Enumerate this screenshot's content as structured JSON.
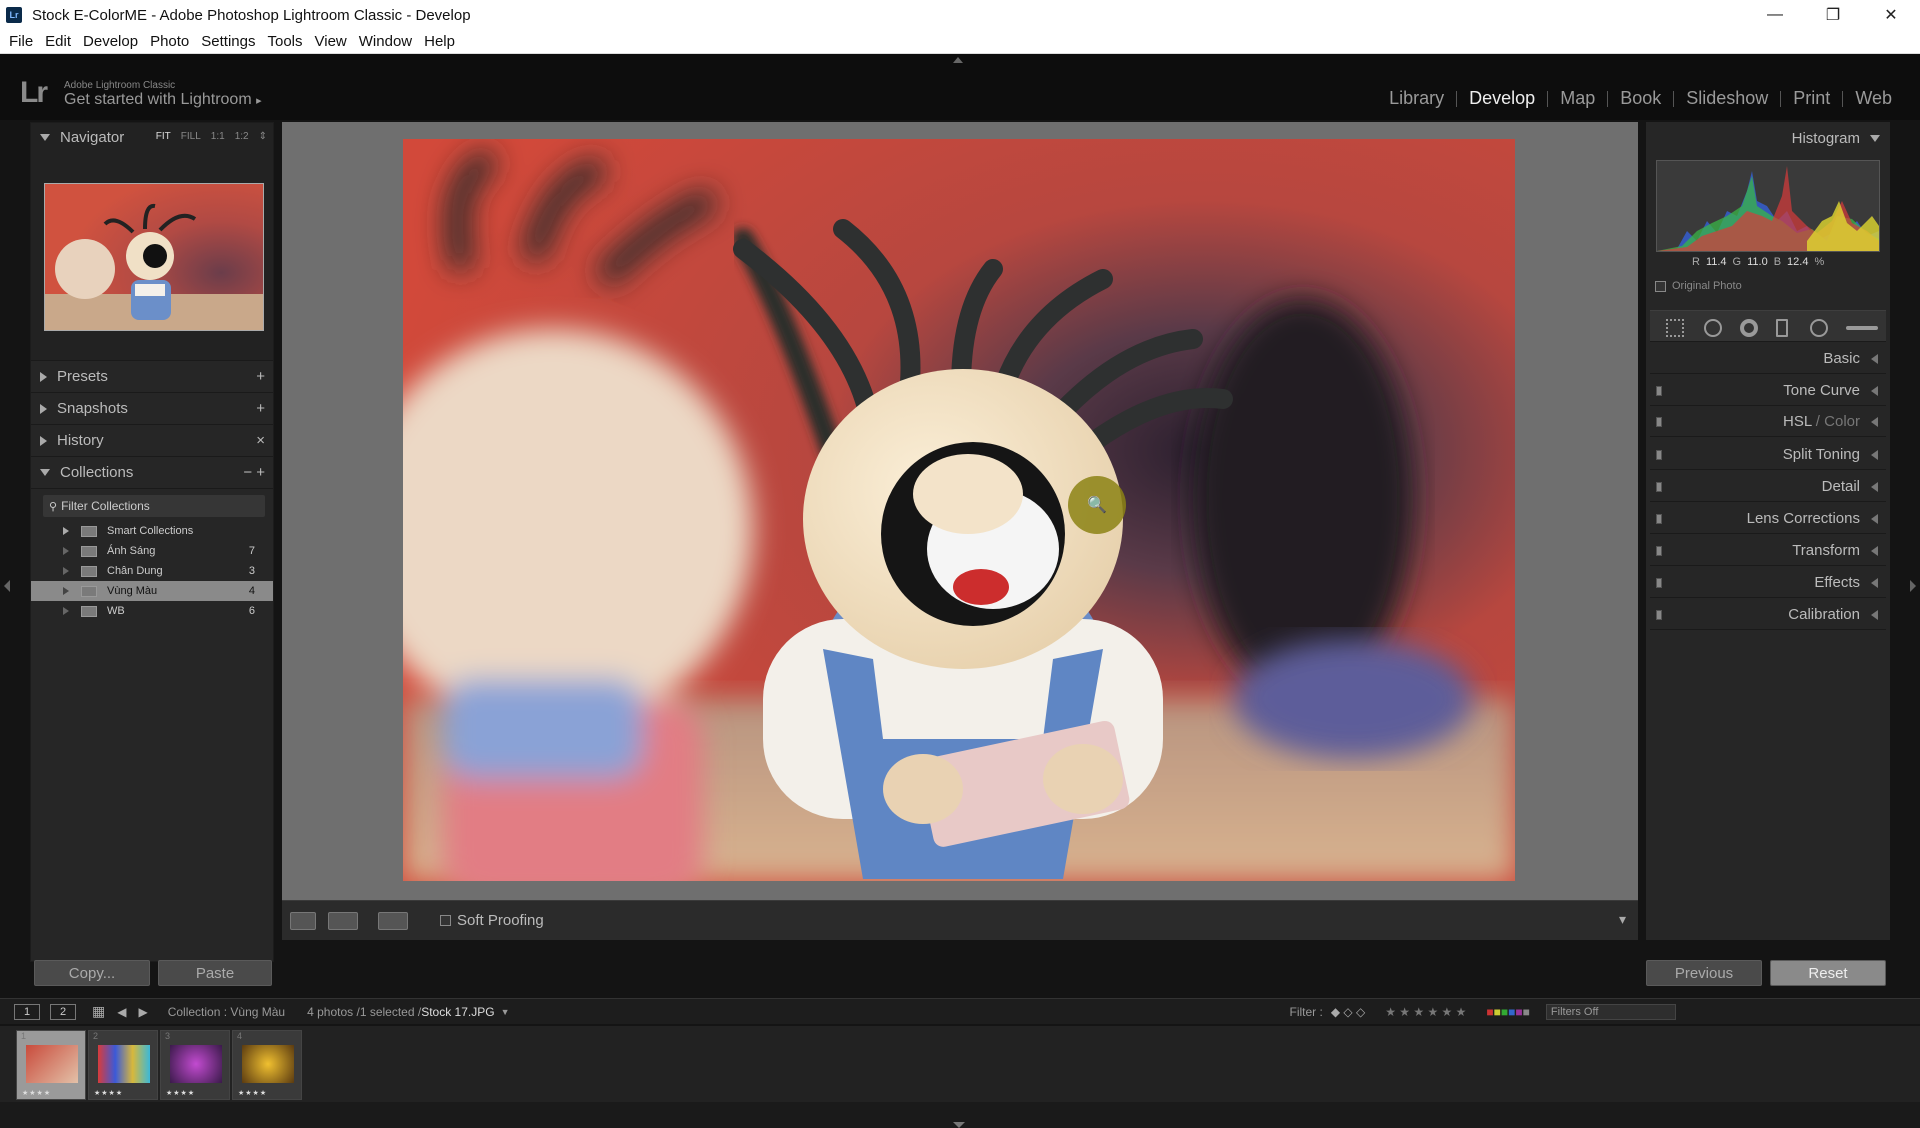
{
  "window": {
    "title": "Stock E-ColorME - Adobe Photoshop Lightroom Classic - Develop",
    "app_icon": "Lr",
    "minimize": "—",
    "restore": "❐",
    "close": "✕"
  },
  "menu": [
    "File",
    "Edit",
    "Develop",
    "Photo",
    "Settings",
    "Tools",
    "View",
    "Window",
    "Help"
  ],
  "identity": {
    "logo": "Lr",
    "small": "Adobe Lightroom Classic",
    "big": "Get started with Lightroom",
    "arrow": "▸"
  },
  "modules": {
    "active": "Develop",
    "items": [
      "Library",
      "Develop",
      "Map",
      "Book",
      "Slideshow",
      "Print",
      "Web"
    ]
  },
  "left": {
    "navigator": {
      "label": "Navigator",
      "zooms": [
        "FIT",
        "FILL",
        "1:1",
        "1:2"
      ],
      "zoom_arrow": "⇕"
    },
    "presets": {
      "label": "Presets",
      "action": "+"
    },
    "snapshots": {
      "label": "Snapshots",
      "action": "+"
    },
    "history": {
      "label": "History",
      "action": "×"
    },
    "collections": {
      "label": "Collections",
      "actions": "−  +",
      "filter_label": "Filter Collections",
      "items": [
        {
          "name": "Smart Collections",
          "count": ""
        },
        {
          "name": "Ánh Sáng",
          "count": "7"
        },
        {
          "name": "Chân Dung",
          "count": "3"
        },
        {
          "name": "Vùng Màu",
          "count": "4"
        },
        {
          "name": "WB",
          "count": "6"
        }
      ],
      "selected_index": 3
    }
  },
  "toolbar": {
    "soft_proofing": "Soft Proofing",
    "dropdown": "▾"
  },
  "right": {
    "histogram": {
      "label": "Histogram",
      "r_label": "R",
      "r": "11.4",
      "g_label": "G",
      "g": "11.0",
      "b_label": "B",
      "b": "12.4",
      "unit": "%",
      "original_photo": "Original Photo"
    },
    "sections": [
      {
        "label": "Basic"
      },
      {
        "label": "Tone Curve"
      },
      {
        "label": "HSL",
        "label2": " / Color"
      },
      {
        "label": "Split Toning"
      },
      {
        "label": "Detail"
      },
      {
        "label": "Lens Corrections"
      },
      {
        "label": "Transform"
      },
      {
        "label": "Effects"
      },
      {
        "label": "Calibration"
      }
    ]
  },
  "buttons": {
    "copy": "Copy...",
    "paste": "Paste",
    "previous": "Previous",
    "reset": "Reset"
  },
  "filmstrip": {
    "screen1": "1",
    "screen2": "2",
    "source": "Collection : Vùng Màu",
    "count": "4 photos /1 selected /",
    "file": "Stock 17.JPG",
    "filter_label": "Filter :",
    "filters_off": "Filters Off",
    "thumbs": [
      {
        "num": "1",
        "stars": "★★★★"
      },
      {
        "num": "2",
        "stars": "★★★★"
      },
      {
        "num": "3",
        "stars": "★★★★"
      },
      {
        "num": "4",
        "stars": "★★★★"
      }
    ]
  },
  "colors": {
    "accent_active": "#eeeeee",
    "zoom_cursor": "#8c8214"
  }
}
